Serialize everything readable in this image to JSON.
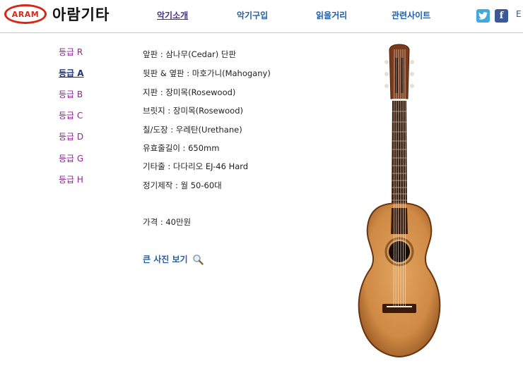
{
  "header": {
    "logo_badge": "ARAM",
    "logo_text": "아람기타",
    "nav": [
      {
        "label": "악기소개",
        "active": true
      },
      {
        "label": "악기구입",
        "active": false
      },
      {
        "label": "읽을거리",
        "active": false
      },
      {
        "label": "관련사이트",
        "active": false
      }
    ],
    "social": {
      "twitter_glyph": "t",
      "facebook_glyph": "f",
      "edge_text": "E"
    }
  },
  "sidebar": {
    "items": [
      {
        "label": "등급 R",
        "active": false
      },
      {
        "label": "등급 A",
        "active": true
      },
      {
        "label": "등급 B",
        "active": false
      },
      {
        "label": "등급 C",
        "active": false
      },
      {
        "label": "등급 D",
        "active": false
      },
      {
        "label": "등급 G",
        "active": false
      },
      {
        "label": "등급 H",
        "active": false
      }
    ]
  },
  "specs": {
    "lines": [
      "앞판 : 삼나무(Cedar) 단판",
      "뒷판 & 옆판 : 마호가니(Mahogany)",
      "지판 : 장미목(Rosewood)",
      "브릿지 : 장미목(Rosewood)",
      "칠/도장 : 우레탄(Urethane)",
      "유효줄길이 : 650mm",
      "기타줄 : 다다리오 EJ-46 Hard",
      "정기제작 : 월 50-60대"
    ],
    "price": "가격 : 40만원"
  },
  "photo_link": {
    "label": "큰 사진 보기",
    "icon": "magnifier-icon"
  },
  "colors": {
    "brand_red": "#d62718",
    "nav_blue": "#1f5fa8",
    "sidebar_purple": "#8a2a8e"
  }
}
